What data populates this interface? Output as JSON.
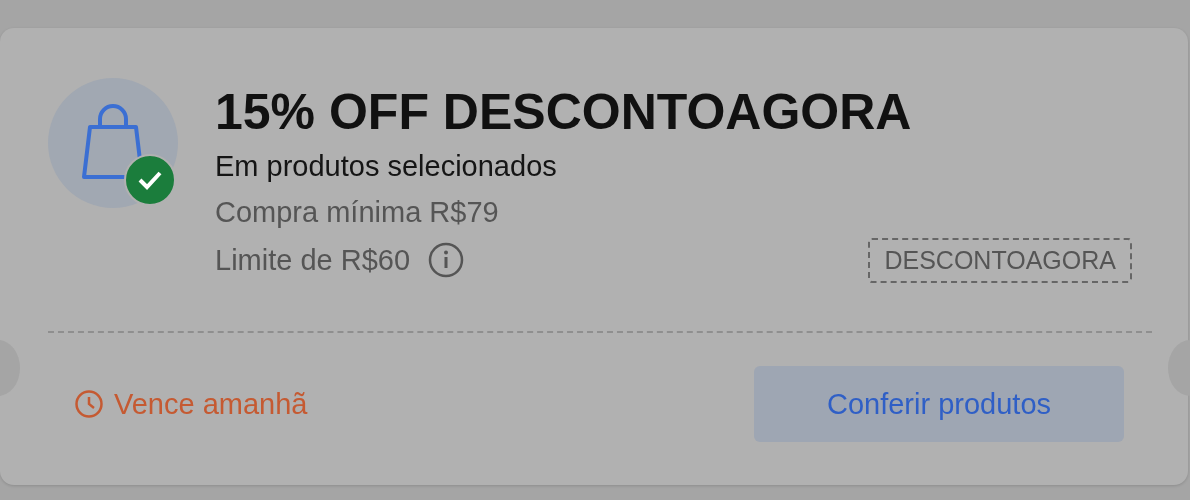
{
  "coupon": {
    "title": "15% OFF DESCONTOAGORA",
    "subtitle": "Em produtos selecionados",
    "minimum": "Compra mínima R$79",
    "limit": "Limite de R$60",
    "code": "DESCONTOAGORA",
    "applied": true,
    "expiry": "Vence amanhã",
    "button": "Conferir produtos"
  }
}
